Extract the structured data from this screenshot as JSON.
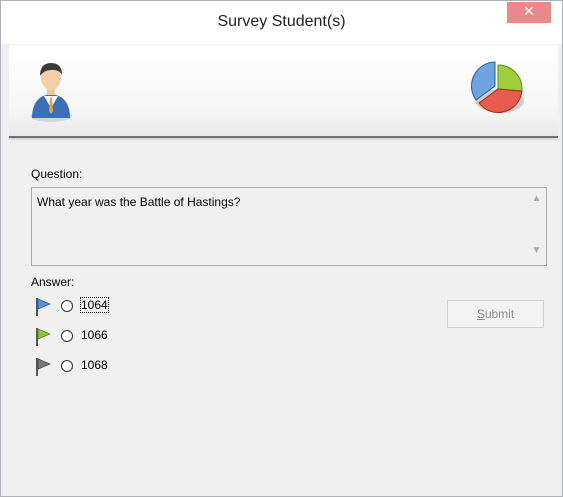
{
  "window": {
    "title": "Survey Student(s)",
    "close_glyph": "✕"
  },
  "banner": {
    "left_icon": "student-avatar-icon",
    "right_icon": "pie-chart-icon"
  },
  "question": {
    "label": "Question:",
    "text": "What year was the Battle of Hastings?"
  },
  "answer": {
    "label": "Answer:",
    "options": [
      {
        "label": "1064",
        "flag_color": "#5b8fd6",
        "selected": false,
        "focused": true
      },
      {
        "label": "1066",
        "flag_color": "#8cc63f",
        "selected": false,
        "focused": false
      },
      {
        "label": "1068",
        "flag_color": "#7a7a7a",
        "selected": false,
        "focused": false
      }
    ]
  },
  "submit": {
    "label_prefix": "",
    "label_underlined": "S",
    "label_rest": "ubmit",
    "enabled": false
  },
  "colors": {
    "close_button_bg": "#e8898c",
    "banner_rule": "#6d7278",
    "disabled_text": "#8d8d8d"
  }
}
